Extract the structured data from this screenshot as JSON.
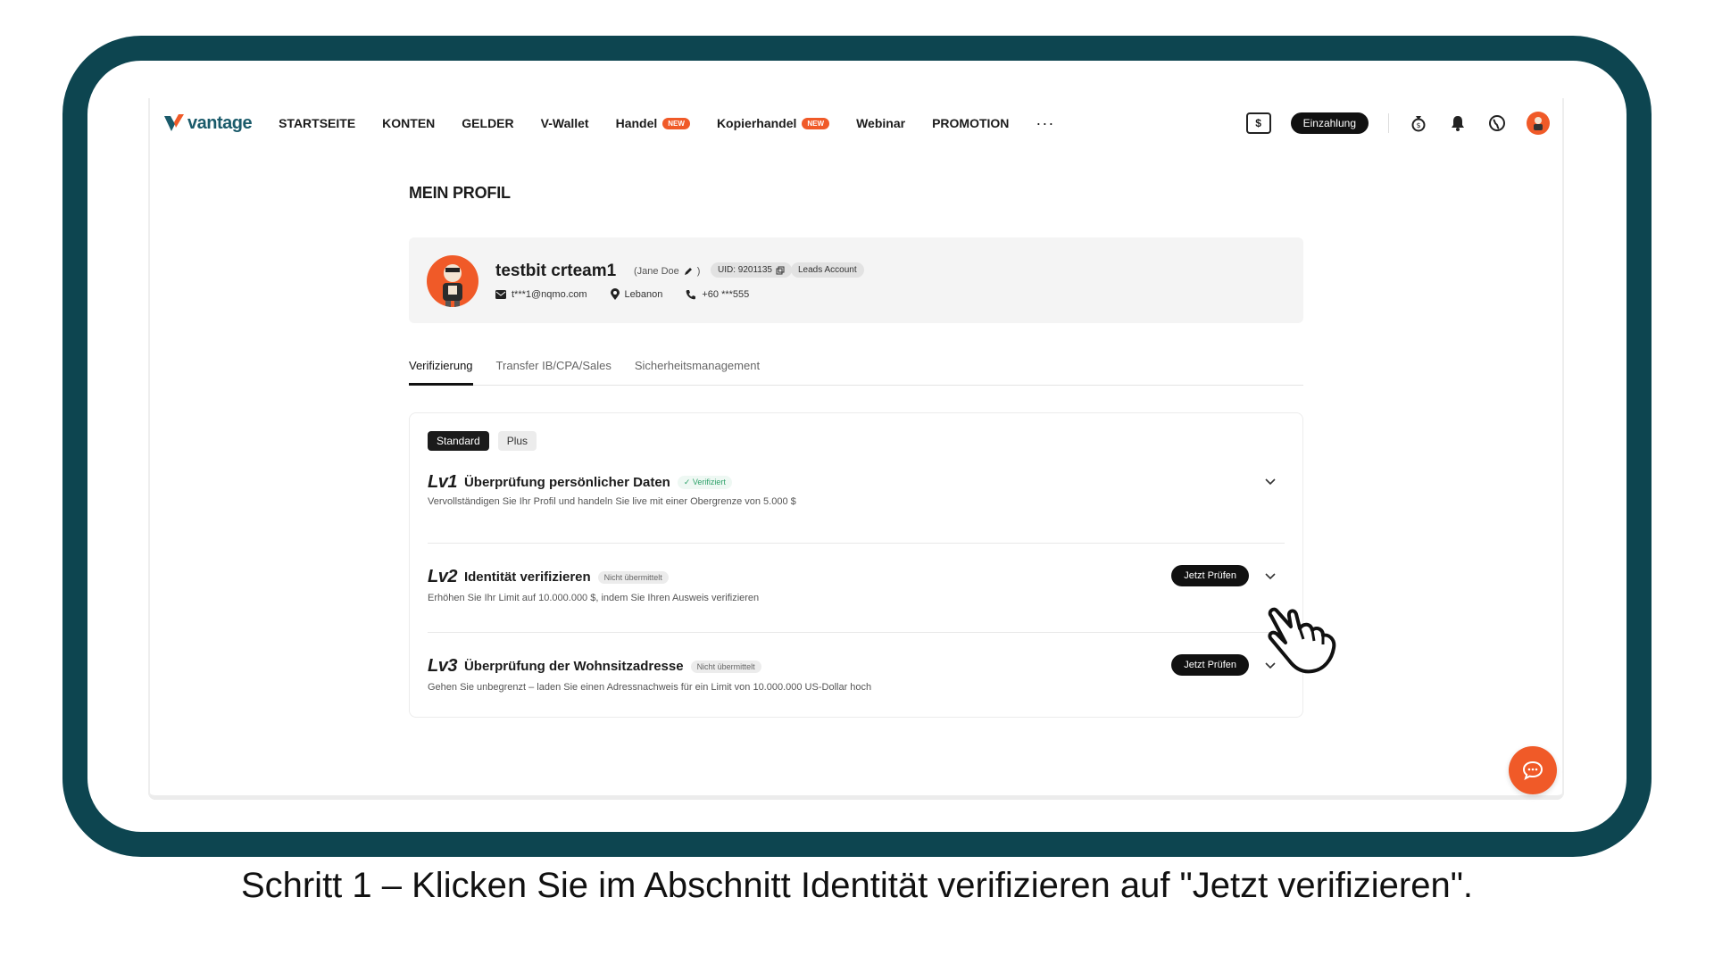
{
  "nav": {
    "brand": "vantage",
    "items": [
      {
        "label": "STARTSEITE",
        "badge": ""
      },
      {
        "label": "KONTEN",
        "badge": ""
      },
      {
        "label": "GELDER",
        "badge": ""
      },
      {
        "label": "V-Wallet",
        "badge": ""
      },
      {
        "label": "Handel",
        "badge": "NEW"
      },
      {
        "label": "Kopierhandel",
        "badge": "NEW"
      },
      {
        "label": "Webinar",
        "badge": ""
      },
      {
        "label": "PROMOTION",
        "badge": ""
      }
    ],
    "more": "···",
    "deposit_icon_symbol": "$",
    "deposit_label": "Einzahlung"
  },
  "page_title": "MEIN PROFIL",
  "profile": {
    "name": "testbit crteam1",
    "alias": "(Jane Doe",
    "uid": "UID: 9201135",
    "account_type": "Leads Account",
    "email": "t***1@nqmo.com",
    "location": "Lebanon",
    "phone": "+60 ***555"
  },
  "tabs": [
    "Verifizierung",
    "Transfer IB/CPA/Sales",
    "Sicherheitsmanagement"
  ],
  "verification": {
    "chips": [
      "Standard",
      "Plus"
    ],
    "levels": [
      {
        "lv": "Lv1",
        "title": "Überprüfung persönlicher Daten",
        "status": "✓ Verifiziert",
        "description": "Vervollständigen Sie Ihr Profil und handeln Sie live mit einer Obergrenze von 5.000 $",
        "button": ""
      },
      {
        "lv": "Lv2",
        "title": "Identität verifizieren",
        "status": "Nicht übermittelt",
        "description": "Erhöhen Sie Ihr Limit auf 10.000.000 $, indem Sie Ihren Ausweis verifizieren",
        "button": "Jetzt Prüfen"
      },
      {
        "lv": "Lv3",
        "title": "Überprüfung der Wohnsitzadresse",
        "status": "Nicht übermittelt",
        "description": "Gehen Sie unbegrenzt – laden Sie einen Adressnachweis für ein Limit von 10.000.000 US-Dollar hoch",
        "button": "Jetzt Prüfen"
      }
    ]
  },
  "caption": "Schritt 1 – Klicken Sie im Abschnitt Identität verifizieren auf \"Jetzt verifizieren\".",
  "colors": {
    "frame": "#0d4550",
    "accent": "#f05a28",
    "brand": "#1a5a6a",
    "button_dark": "#111111"
  }
}
